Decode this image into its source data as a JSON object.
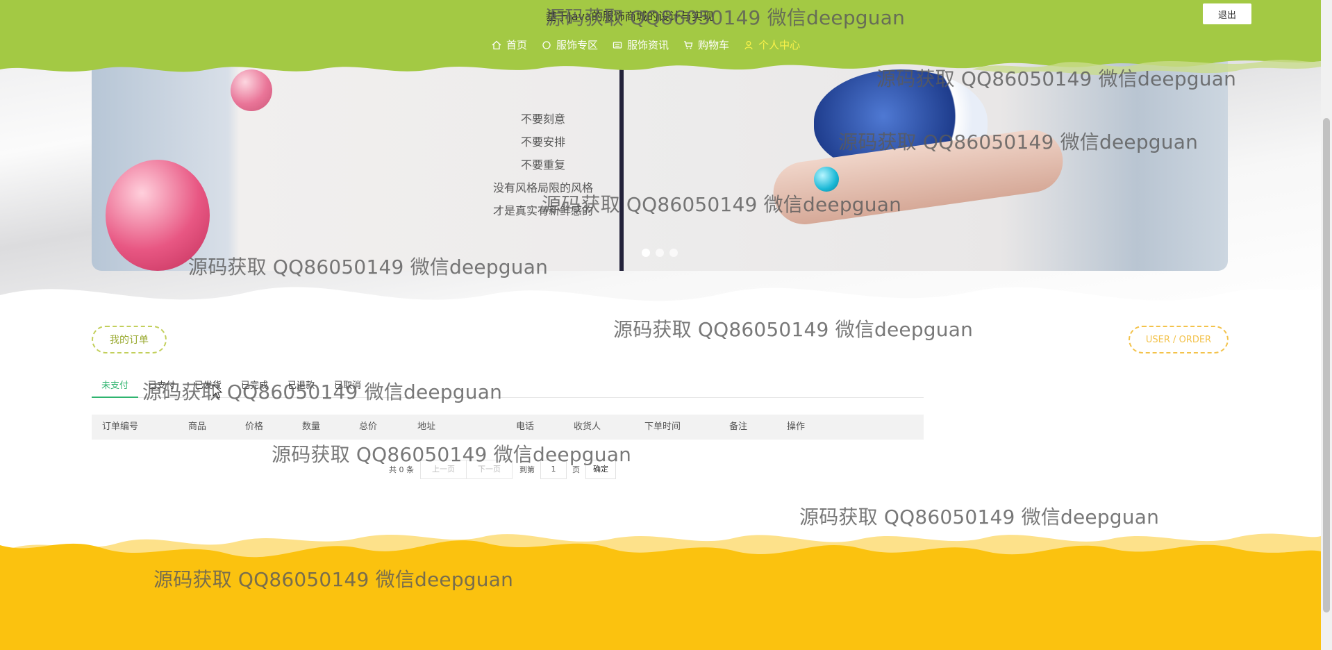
{
  "header": {
    "site_title": "基于Java的服饰商城的设计与实现",
    "logout_label": "退出",
    "nav": [
      {
        "label": "首页",
        "icon": "home-icon",
        "active": false
      },
      {
        "label": "服饰专区",
        "icon": "circle-icon",
        "active": false
      },
      {
        "label": "服饰资讯",
        "icon": "news-icon",
        "active": false
      },
      {
        "label": "购物车",
        "icon": "cart-icon",
        "active": false
      },
      {
        "label": "个人中心",
        "icon": "user-icon",
        "active": true
      }
    ],
    "colors": {
      "bar": "#a3c944",
      "active": "#f9f24a"
    }
  },
  "banner": {
    "poem_lines": [
      "不要刻意",
      "不要安排",
      "不要重复",
      "没有风格局限的风格",
      "才是真实有新鲜感的"
    ],
    "slide_count": 3
  },
  "section": {
    "title": "我的订单",
    "subtitle": "USER / ORDER"
  },
  "tabs": [
    "未支付",
    "已支付",
    "已发货",
    "已完成",
    "已退款",
    "已取消"
  ],
  "table": {
    "columns": [
      "订单编号",
      "商品",
      "价格",
      "数量",
      "总价",
      "地址",
      "电话",
      "收货人",
      "下单时间",
      "备注",
      "操作"
    ],
    "rows": []
  },
  "pagination": {
    "total": "共 0 条",
    "prev": "上一页",
    "next": "下一页",
    "goto_label": "到第",
    "page_value": "1",
    "page_suffix": "页",
    "confirm": "确定"
  },
  "watermark": "源码获取 QQ86050149 微信deepguan",
  "footer_color": "#fbc20f"
}
